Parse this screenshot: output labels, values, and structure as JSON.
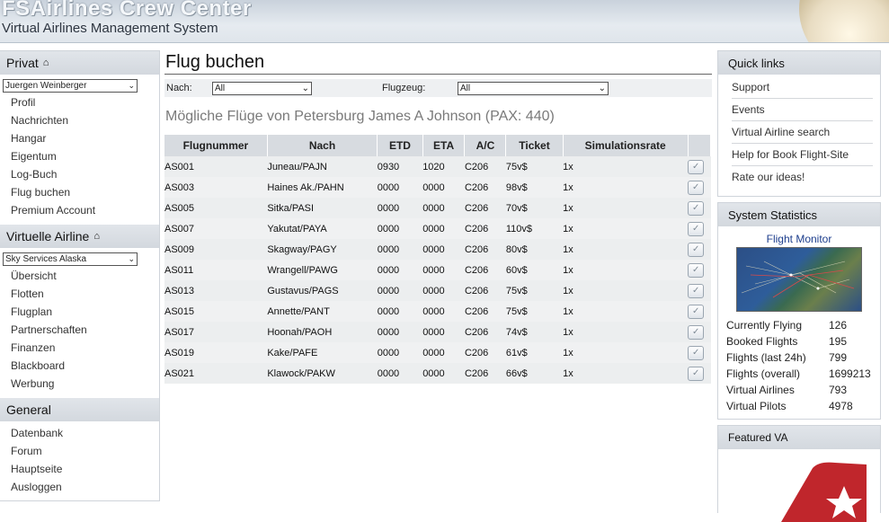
{
  "header": {
    "title": "FSAirlines Crew Center",
    "subtitle": "Virtual Airlines Management System"
  },
  "sidebar": {
    "privat": {
      "title": "Privat",
      "select_value": "Juergen Weinberger",
      "items": [
        "Profil",
        "Nachrichten",
        "Hangar",
        "Eigentum",
        "Log-Buch",
        "Flug buchen",
        "Premium Account"
      ]
    },
    "airline": {
      "title": "Virtuelle Airline",
      "select_value": "Sky Services Alaska",
      "items": [
        "Übersicht",
        "Flotten",
        "Flugplan",
        "Partnerschaften",
        "Finanzen",
        "Blackboard",
        "Werbung"
      ]
    },
    "general": {
      "title": "General",
      "items": [
        "Datenbank",
        "Forum",
        "Hauptseite",
        "Ausloggen"
      ]
    }
  },
  "main": {
    "title": "Flug buchen",
    "filter": {
      "nach_label": "Nach:",
      "nach_value": "All",
      "flugzeug_label": "Flugzeug:",
      "flugzeug_value": "All"
    },
    "subtitle": "Mögliche Flüge von Petersburg James A Johnson (PAX: 440)",
    "columns": [
      "Flugnummer",
      "Nach",
      "ETD",
      "ETA",
      "A/C",
      "Ticket",
      "Simulationsrate"
    ],
    "rows": [
      {
        "flight": "AS001",
        "dest": "Juneau/PAJN",
        "etd": "0930",
        "eta": "1020",
        "ac": "C206",
        "ticket": "75v$",
        "rate": "1x"
      },
      {
        "flight": "AS003",
        "dest": "Haines Ak./PAHN",
        "etd": "0000",
        "eta": "0000",
        "ac": "C206",
        "ticket": "98v$",
        "rate": "1x"
      },
      {
        "flight": "AS005",
        "dest": "Sitka/PASI",
        "etd": "0000",
        "eta": "0000",
        "ac": "C206",
        "ticket": "70v$",
        "rate": "1x"
      },
      {
        "flight": "AS007",
        "dest": "Yakutat/PAYA",
        "etd": "0000",
        "eta": "0000",
        "ac": "C206",
        "ticket": "110v$",
        "rate": "1x"
      },
      {
        "flight": "AS009",
        "dest": "Skagway/PAGY",
        "etd": "0000",
        "eta": "0000",
        "ac": "C206",
        "ticket": "80v$",
        "rate": "1x"
      },
      {
        "flight": "AS011",
        "dest": "Wrangell/PAWG",
        "etd": "0000",
        "eta": "0000",
        "ac": "C206",
        "ticket": "60v$",
        "rate": "1x"
      },
      {
        "flight": "AS013",
        "dest": "Gustavus/PAGS",
        "etd": "0000",
        "eta": "0000",
        "ac": "C206",
        "ticket": "75v$",
        "rate": "1x"
      },
      {
        "flight": "AS015",
        "dest": "Annette/PANT",
        "etd": "0000",
        "eta": "0000",
        "ac": "C206",
        "ticket": "75v$",
        "rate": "1x"
      },
      {
        "flight": "AS017",
        "dest": "Hoonah/PAOH",
        "etd": "0000",
        "eta": "0000",
        "ac": "C206",
        "ticket": "74v$",
        "rate": "1x"
      },
      {
        "flight": "AS019",
        "dest": "Kake/PAFE",
        "etd": "0000",
        "eta": "0000",
        "ac": "C206",
        "ticket": "61v$",
        "rate": "1x"
      },
      {
        "flight": "AS021",
        "dest": "Klawock/PAKW",
        "etd": "0000",
        "eta": "0000",
        "ac": "C206",
        "ticket": "66v$",
        "rate": "1x"
      }
    ]
  },
  "quick_links": {
    "title": "Quick links",
    "items": [
      "Support",
      "Events",
      "Virtual Airline search",
      "Help for Book Flight-Site",
      "Rate our ideas!"
    ]
  },
  "system_statistics": {
    "title": "System Statistics",
    "monitor_title": "Flight Monitor",
    "rows": [
      {
        "label": "Currently Flying",
        "value": "126"
      },
      {
        "label": "Booked Flights",
        "value": "195"
      },
      {
        "label": "Flights (last 24h)",
        "value": "799"
      },
      {
        "label": "Flights (overall)",
        "value": "1699213"
      },
      {
        "label": "Virtual Airlines",
        "value": "793"
      },
      {
        "label": "Virtual Pilots",
        "value": "4978"
      }
    ]
  },
  "featured": {
    "title": "Featured VA"
  },
  "icons": {
    "home": "home-icon",
    "book": "book-flight-icon",
    "dropdown": "chevron-down-icon"
  },
  "colors": {
    "panel_header": "#d7dbe0",
    "destination_text": "#8a8f97",
    "monitor_title": "#1c3d8c",
    "featured_logo": "#c0262c"
  }
}
